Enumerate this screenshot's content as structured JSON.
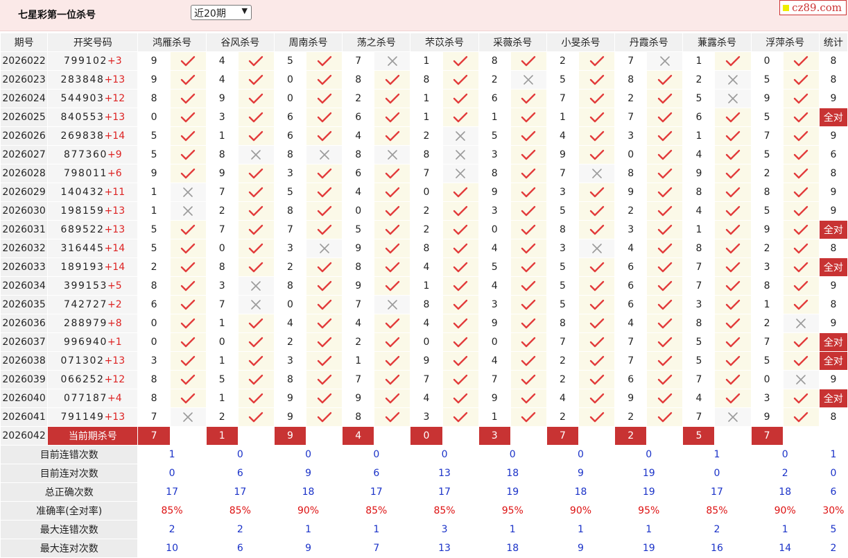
{
  "header": {
    "title": "七星彩第一位杀号",
    "select_value": "近20期",
    "logo": "cz89.com"
  },
  "columns": {
    "period": "期号",
    "draw": "开奖号码",
    "experts": [
      "鸿雁杀号",
      "谷风杀号",
      "周南杀号",
      "荡之杀号",
      "芣苡杀号",
      "采薇杀号",
      "小旻杀号",
      "丹霞杀号",
      "蒹露杀号",
      "浮萍杀号"
    ],
    "stat": "统计"
  },
  "rows": [
    {
      "period": "2026022",
      "draw": "799102",
      "plus": "+3",
      "picks": [
        "9",
        "4",
        "5",
        "7",
        "1",
        "8",
        "2",
        "7",
        "1",
        "0"
      ],
      "results": [
        1,
        1,
        1,
        0,
        1,
        1,
        1,
        0,
        1,
        1
      ],
      "stat": "8"
    },
    {
      "period": "2026023",
      "draw": "283848",
      "plus": "+13",
      "picks": [
        "9",
        "4",
        "0",
        "8",
        "8",
        "2",
        "5",
        "8",
        "2",
        "5"
      ],
      "results": [
        1,
        1,
        1,
        1,
        1,
        0,
        1,
        1,
        0,
        1
      ],
      "stat": "8"
    },
    {
      "period": "2026024",
      "draw": "544903",
      "plus": "+12",
      "picks": [
        "8",
        "9",
        "0",
        "2",
        "1",
        "6",
        "7",
        "2",
        "5",
        "9"
      ],
      "results": [
        1,
        1,
        1,
        1,
        1,
        1,
        1,
        1,
        0,
        1
      ],
      "stat": "9"
    },
    {
      "period": "2026025",
      "draw": "840553",
      "plus": "+13",
      "picks": [
        "0",
        "3",
        "6",
        "6",
        "1",
        "1",
        "1",
        "7",
        "6",
        "5"
      ],
      "results": [
        1,
        1,
        1,
        1,
        1,
        1,
        1,
        1,
        1,
        1
      ],
      "stat": "全对"
    },
    {
      "period": "2026026",
      "draw": "269838",
      "plus": "+14",
      "picks": [
        "5",
        "1",
        "6",
        "4",
        "2",
        "5",
        "4",
        "3",
        "1",
        "7"
      ],
      "results": [
        1,
        1,
        1,
        1,
        0,
        1,
        1,
        1,
        1,
        1
      ],
      "stat": "9"
    },
    {
      "period": "2026027",
      "draw": "877360",
      "plus": "+9",
      "picks": [
        "5",
        "8",
        "8",
        "8",
        "8",
        "3",
        "9",
        "0",
        "4",
        "5"
      ],
      "results": [
        1,
        0,
        0,
        0,
        0,
        1,
        1,
        1,
        1,
        1
      ],
      "stat": "6"
    },
    {
      "period": "2026028",
      "draw": "798011",
      "plus": "+6",
      "picks": [
        "9",
        "9",
        "3",
        "6",
        "7",
        "8",
        "7",
        "8",
        "9",
        "2"
      ],
      "results": [
        1,
        1,
        1,
        1,
        0,
        1,
        0,
        1,
        1,
        1
      ],
      "stat": "8"
    },
    {
      "period": "2026029",
      "draw": "140432",
      "plus": "+11",
      "picks": [
        "1",
        "7",
        "5",
        "4",
        "0",
        "9",
        "3",
        "9",
        "8",
        "8"
      ],
      "results": [
        0,
        1,
        1,
        1,
        1,
        1,
        1,
        1,
        1,
        1
      ],
      "stat": "9"
    },
    {
      "period": "2026030",
      "draw": "198159",
      "plus": "+13",
      "picks": [
        "1",
        "2",
        "8",
        "0",
        "2",
        "3",
        "5",
        "2",
        "4",
        "5"
      ],
      "results": [
        0,
        1,
        1,
        1,
        1,
        1,
        1,
        1,
        1,
        1
      ],
      "stat": "9"
    },
    {
      "period": "2026031",
      "draw": "689522",
      "plus": "+13",
      "picks": [
        "5",
        "7",
        "7",
        "5",
        "2",
        "0",
        "8",
        "3",
        "1",
        "9"
      ],
      "results": [
        1,
        1,
        1,
        1,
        1,
        1,
        1,
        1,
        1,
        1
      ],
      "stat": "全对"
    },
    {
      "period": "2026032",
      "draw": "316445",
      "plus": "+14",
      "picks": [
        "5",
        "0",
        "3",
        "9",
        "8",
        "4",
        "3",
        "4",
        "8",
        "2"
      ],
      "results": [
        1,
        1,
        0,
        1,
        1,
        1,
        0,
        1,
        1,
        1
      ],
      "stat": "8"
    },
    {
      "period": "2026033",
      "draw": "189193",
      "plus": "+14",
      "picks": [
        "2",
        "8",
        "2",
        "8",
        "4",
        "5",
        "5",
        "6",
        "7",
        "3"
      ],
      "results": [
        1,
        1,
        1,
        1,
        1,
        1,
        1,
        1,
        1,
        1
      ],
      "stat": "全对"
    },
    {
      "period": "2026034",
      "draw": "399153",
      "plus": "+5",
      "picks": [
        "8",
        "3",
        "8",
        "9",
        "1",
        "4",
        "5",
        "6",
        "7",
        "8"
      ],
      "results": [
        1,
        0,
        1,
        1,
        1,
        1,
        1,
        1,
        1,
        1
      ],
      "stat": "9"
    },
    {
      "period": "2026035",
      "draw": "742727",
      "plus": "+2",
      "picks": [
        "6",
        "7",
        "0",
        "7",
        "8",
        "3",
        "5",
        "6",
        "3",
        "1"
      ],
      "results": [
        1,
        0,
        1,
        0,
        1,
        1,
        1,
        1,
        1,
        1
      ],
      "stat": "8"
    },
    {
      "period": "2026036",
      "draw": "288979",
      "plus": "+8",
      "picks": [
        "0",
        "1",
        "4",
        "4",
        "4",
        "9",
        "8",
        "4",
        "8",
        "2"
      ],
      "results": [
        1,
        1,
        1,
        1,
        1,
        1,
        1,
        1,
        1,
        0
      ],
      "stat": "9"
    },
    {
      "period": "2026037",
      "draw": "996940",
      "plus": "+1",
      "picks": [
        "0",
        "0",
        "2",
        "2",
        "0",
        "0",
        "7",
        "7",
        "5",
        "7"
      ],
      "results": [
        1,
        1,
        1,
        1,
        1,
        1,
        1,
        1,
        1,
        1
      ],
      "stat": "全对"
    },
    {
      "period": "2026038",
      "draw": "071302",
      "plus": "+13",
      "picks": [
        "3",
        "1",
        "3",
        "1",
        "9",
        "4",
        "2",
        "7",
        "5",
        "5"
      ],
      "results": [
        1,
        1,
        1,
        1,
        1,
        1,
        1,
        1,
        1,
        1
      ],
      "stat": "全对"
    },
    {
      "period": "2026039",
      "draw": "066252",
      "plus": "+12",
      "picks": [
        "8",
        "5",
        "8",
        "7",
        "7",
        "7",
        "2",
        "6",
        "7",
        "0"
      ],
      "results": [
        1,
        1,
        1,
        1,
        1,
        1,
        1,
        1,
        1,
        0
      ],
      "stat": "9"
    },
    {
      "period": "2026040",
      "draw": "077187",
      "plus": "+4",
      "picks": [
        "8",
        "1",
        "9",
        "9",
        "4",
        "9",
        "4",
        "9",
        "4",
        "3"
      ],
      "results": [
        1,
        1,
        1,
        1,
        1,
        1,
        1,
        1,
        1,
        1
      ],
      "stat": "全对"
    },
    {
      "period": "2026041",
      "draw": "791149",
      "plus": "+13",
      "picks": [
        "7",
        "2",
        "9",
        "8",
        "3",
        "1",
        "2",
        "2",
        "7",
        "9"
      ],
      "results": [
        0,
        1,
        1,
        1,
        1,
        1,
        1,
        1,
        0,
        1
      ],
      "stat": "8"
    }
  ],
  "current": {
    "period": "2026042",
    "label": "当前期杀号",
    "picks": [
      "7",
      "1",
      "9",
      "4",
      "0",
      "3",
      "7",
      "2",
      "5",
      "7"
    ]
  },
  "summary": [
    {
      "label": "目前连错次数",
      "values": [
        "1",
        "0",
        "0",
        "0",
        "0",
        "0",
        "0",
        "0",
        "1",
        "0"
      ],
      "stat": "1",
      "color": "blue"
    },
    {
      "label": "目前连对次数",
      "values": [
        "0",
        "6",
        "9",
        "6",
        "13",
        "18",
        "9",
        "19",
        "0",
        "2"
      ],
      "stat": "0",
      "color": "blue"
    },
    {
      "label": "总正确次数",
      "values": [
        "17",
        "17",
        "18",
        "17",
        "17",
        "19",
        "18",
        "19",
        "17",
        "18"
      ],
      "stat": "6",
      "color": "blue"
    },
    {
      "label": "准确率(全对率)",
      "values": [
        "85%",
        "85%",
        "90%",
        "85%",
        "85%",
        "95%",
        "90%",
        "95%",
        "85%",
        "90%"
      ],
      "stat": "30%",
      "color": "red"
    },
    {
      "label": "最大连错次数",
      "values": [
        "2",
        "2",
        "1",
        "1",
        "3",
        "1",
        "1",
        "1",
        "2",
        "1"
      ],
      "stat": "5",
      "color": "blue"
    },
    {
      "label": "最大连对次数",
      "values": [
        "10",
        "6",
        "9",
        "7",
        "13",
        "18",
        "9",
        "19",
        "16",
        "14"
      ],
      "stat": "2",
      "color": "blue"
    }
  ],
  "colors": {
    "accent_red": "#c83333",
    "check_red": "#e23b3b",
    "cross_gray": "#9a9a9a",
    "stat_blue": "#1a32c8"
  }
}
